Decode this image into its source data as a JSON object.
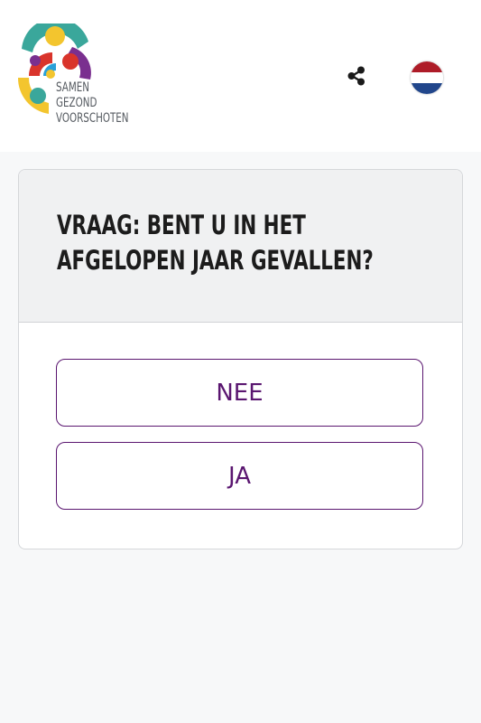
{
  "header": {
    "logo": {
      "lines": [
        "SAMEN",
        "GEZOND",
        "VOORSCHOTEN"
      ],
      "colors": [
        "#3aa79b",
        "#f3c52e",
        "#7a2f8f",
        "#d9342b",
        "#2aa0d8"
      ]
    },
    "share_icon": "share-icon",
    "language_icon": "netherlands-flag-icon",
    "flag_colors": [
      "#ae1c28",
      "#ffffff",
      "#21468b"
    ]
  },
  "card": {
    "question": "VRAAG: BENT U IN HET AFGELOPEN JAAR GEVALLEN?",
    "answers": [
      {
        "label": "NEE"
      },
      {
        "label": "JA"
      }
    ]
  },
  "theme": {
    "accent": "#5a1670",
    "header_bg": "#ffffff",
    "page_bg": "#f7f8f9",
    "card_head_bg": "#f0f1f2"
  }
}
